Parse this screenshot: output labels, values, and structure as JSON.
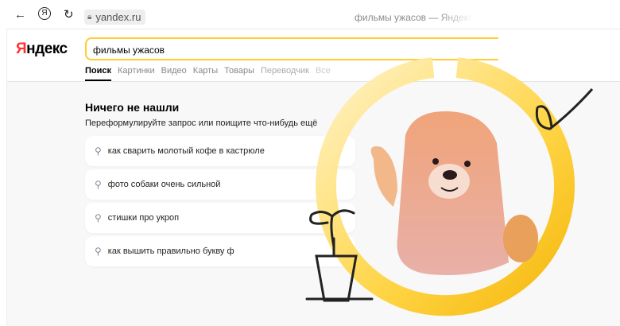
{
  "browser": {
    "url": "yandex.ru",
    "tab_title": "фильмы ужасов — Яндекс"
  },
  "logo": {
    "red": "Я",
    "rest": "ндекс"
  },
  "search": {
    "value": "фильмы ужасов"
  },
  "tabs": [
    "Поиск",
    "Картинки",
    "Видео",
    "Карты",
    "Товары",
    "Переводчик",
    "Все"
  ],
  "empty": {
    "title": "Ничего не нашли",
    "subtitle": "Переформулируйте запрос или поищите что-нибудь ещё"
  },
  "suggestions": [
    "как сварить молотый кофе в кастрюле",
    "фото собаки очень сильной",
    "стишки про укроп",
    "как вышить правильно букву ф"
  ],
  "colors": {
    "accent": "#ffcc33",
    "logo_red": "#ff3333"
  }
}
